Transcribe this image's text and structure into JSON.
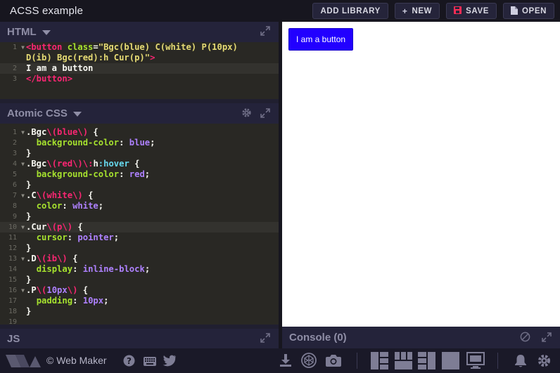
{
  "app": {
    "title": "ACSS example"
  },
  "toolbar": {
    "add_library": "ADD LIBRARY",
    "new": "NEW",
    "save": "SAVE",
    "open": "OPEN"
  },
  "html_panel": {
    "title": "HTML",
    "lines": [
      {
        "n": "1",
        "fold": true,
        "tokens": [
          [
            "tag",
            "<button "
          ],
          [
            "attr",
            "class"
          ],
          [
            "plain",
            "="
          ],
          [
            "str",
            "\"Bgc(blue) C(white) P(10px)"
          ]
        ]
      },
      {
        "n": "",
        "fold": false,
        "tokens": [
          [
            "str",
            "D(ib) Bgc(red):h Cur(p)\""
          ],
          [
            "tag",
            ">"
          ]
        ]
      },
      {
        "n": "2",
        "fold": false,
        "active": true,
        "tokens": [
          [
            "plain",
            "I am a button"
          ]
        ]
      },
      {
        "n": "3",
        "fold": false,
        "tokens": [
          [
            "tag",
            "</button>"
          ]
        ]
      }
    ]
  },
  "css_panel": {
    "title": "Atomic CSS",
    "lines": [
      {
        "n": "1",
        "fold": true,
        "tokens": [
          [
            "plain",
            ".Bgc"
          ],
          [
            "tag",
            "\\("
          ],
          [
            "tag",
            "blue"
          ],
          [
            "tag",
            "\\)"
          ],
          [
            "plain",
            " {"
          ]
        ]
      },
      {
        "n": "2",
        "tokens": [
          [
            "plain",
            "  "
          ],
          [
            "attr",
            "background-color"
          ],
          [
            "plain",
            ": "
          ],
          [
            "num",
            "blue"
          ],
          [
            "plain",
            ";"
          ]
        ]
      },
      {
        "n": "3",
        "tokens": [
          [
            "plain",
            "}"
          ]
        ]
      },
      {
        "n": "4",
        "fold": true,
        "tokens": [
          [
            "plain",
            ".Bgc"
          ],
          [
            "tag",
            "\\("
          ],
          [
            "tag",
            "red"
          ],
          [
            "tag",
            "\\)"
          ],
          [
            "tag",
            "\\:"
          ],
          [
            "plain",
            "h"
          ],
          [
            "kw",
            ":hover"
          ],
          [
            "plain",
            " {"
          ]
        ]
      },
      {
        "n": "5",
        "tokens": [
          [
            "plain",
            "  "
          ],
          [
            "attr",
            "background-color"
          ],
          [
            "plain",
            ": "
          ],
          [
            "num",
            "red"
          ],
          [
            "plain",
            ";"
          ]
        ]
      },
      {
        "n": "6",
        "tokens": [
          [
            "plain",
            "}"
          ]
        ]
      },
      {
        "n": "7",
        "fold": true,
        "tokens": [
          [
            "plain",
            ".C"
          ],
          [
            "tag",
            "\\("
          ],
          [
            "tag",
            "white"
          ],
          [
            "tag",
            "\\)"
          ],
          [
            "plain",
            " {"
          ]
        ]
      },
      {
        "n": "8",
        "tokens": [
          [
            "plain",
            "  "
          ],
          [
            "attr",
            "color"
          ],
          [
            "plain",
            ": "
          ],
          [
            "num",
            "white"
          ],
          [
            "plain",
            ";"
          ]
        ]
      },
      {
        "n": "9",
        "tokens": [
          [
            "plain",
            "}"
          ]
        ]
      },
      {
        "n": "10",
        "fold": true,
        "active": true,
        "tokens": [
          [
            "plain",
            ".Cur"
          ],
          [
            "tag",
            "\\("
          ],
          [
            "tag",
            "p"
          ],
          [
            "tag",
            "\\)"
          ],
          [
            "plain",
            " {"
          ]
        ]
      },
      {
        "n": "11",
        "tokens": [
          [
            "plain",
            "  "
          ],
          [
            "attr",
            "cursor"
          ],
          [
            "plain",
            ": "
          ],
          [
            "num",
            "pointer"
          ],
          [
            "plain",
            ";"
          ]
        ]
      },
      {
        "n": "12",
        "tokens": [
          [
            "plain",
            "}"
          ]
        ]
      },
      {
        "n": "13",
        "fold": true,
        "tokens": [
          [
            "plain",
            ".D"
          ],
          [
            "tag",
            "\\("
          ],
          [
            "tag",
            "ib"
          ],
          [
            "tag",
            "\\)"
          ],
          [
            "plain",
            " {"
          ]
        ]
      },
      {
        "n": "14",
        "tokens": [
          [
            "plain",
            "  "
          ],
          [
            "attr",
            "display"
          ],
          [
            "plain",
            ": "
          ],
          [
            "num",
            "inline-block"
          ],
          [
            "plain",
            ";"
          ]
        ]
      },
      {
        "n": "15",
        "tokens": [
          [
            "plain",
            "}"
          ]
        ]
      },
      {
        "n": "16",
        "fold": true,
        "tokens": [
          [
            "plain",
            ".P"
          ],
          [
            "tag",
            "\\("
          ],
          [
            "num",
            "10px"
          ],
          [
            "tag",
            "\\)"
          ],
          [
            "plain",
            " {"
          ]
        ]
      },
      {
        "n": "17",
        "tokens": [
          [
            "plain",
            "  "
          ],
          [
            "attr",
            "padding"
          ],
          [
            "plain",
            ": "
          ],
          [
            "num",
            "10px"
          ],
          [
            "plain",
            ";"
          ]
        ]
      },
      {
        "n": "18",
        "tokens": [
          [
            "plain",
            "}"
          ]
        ]
      },
      {
        "n": "19",
        "tokens": []
      }
    ]
  },
  "js_panel": {
    "title": "JS"
  },
  "preview": {
    "button_label": "I am a button"
  },
  "console": {
    "title": "Console (0)"
  },
  "footer": {
    "credit": "© Web Maker"
  },
  "colors": {
    "accent": "#2200ff",
    "save_icon": "#ff2d55",
    "editor_bg": "#292824"
  }
}
